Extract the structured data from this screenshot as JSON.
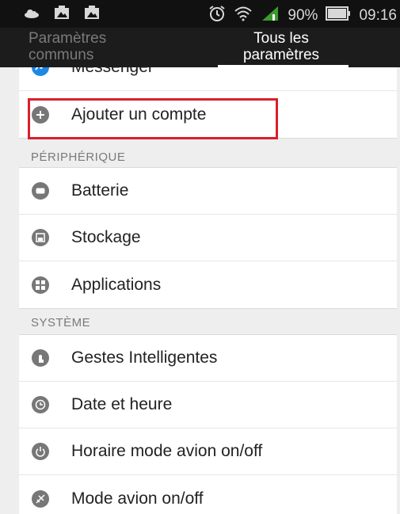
{
  "status_bar": {
    "battery_percent": "90%",
    "time": "09:16",
    "icons": [
      "cloud-icon",
      "image-icon",
      "image-icon",
      "alarm-icon",
      "wifi-icon",
      "signal-icon",
      "battery-icon"
    ]
  },
  "tabs": [
    {
      "label_line1": "Paramètres",
      "label_line2": "communs",
      "selected": false
    },
    {
      "label_line1": "Tous les",
      "label_line2": "paramètres",
      "selected": true
    }
  ],
  "accounts_section": {
    "items": [
      {
        "label": "Messenger",
        "icon": "messenger-icon"
      },
      {
        "label": "Ajouter un compte",
        "icon": "plus-circle-icon"
      }
    ]
  },
  "device_section": {
    "header": "PÉRIPHÉRIQUE",
    "items": [
      {
        "label": "Batterie",
        "icon": "battery-icon"
      },
      {
        "label": "Stockage",
        "icon": "storage-icon"
      },
      {
        "label": "Applications",
        "icon": "apps-icon"
      }
    ]
  },
  "system_section": {
    "header": "SYSTÈME",
    "items": [
      {
        "label": "Gestes Intelligentes",
        "icon": "gesture-icon"
      },
      {
        "label": "Date et heure",
        "icon": "clock-icon"
      },
      {
        "label": "Horaire mode avion on/off",
        "icon": "power-icon"
      },
      {
        "label": "Mode avion on/off",
        "icon": "airplane-icon"
      }
    ]
  },
  "colors": {
    "highlight": "#d8202c",
    "messenger_blue": "#1e88e5",
    "icon_gray": "#777777"
  }
}
